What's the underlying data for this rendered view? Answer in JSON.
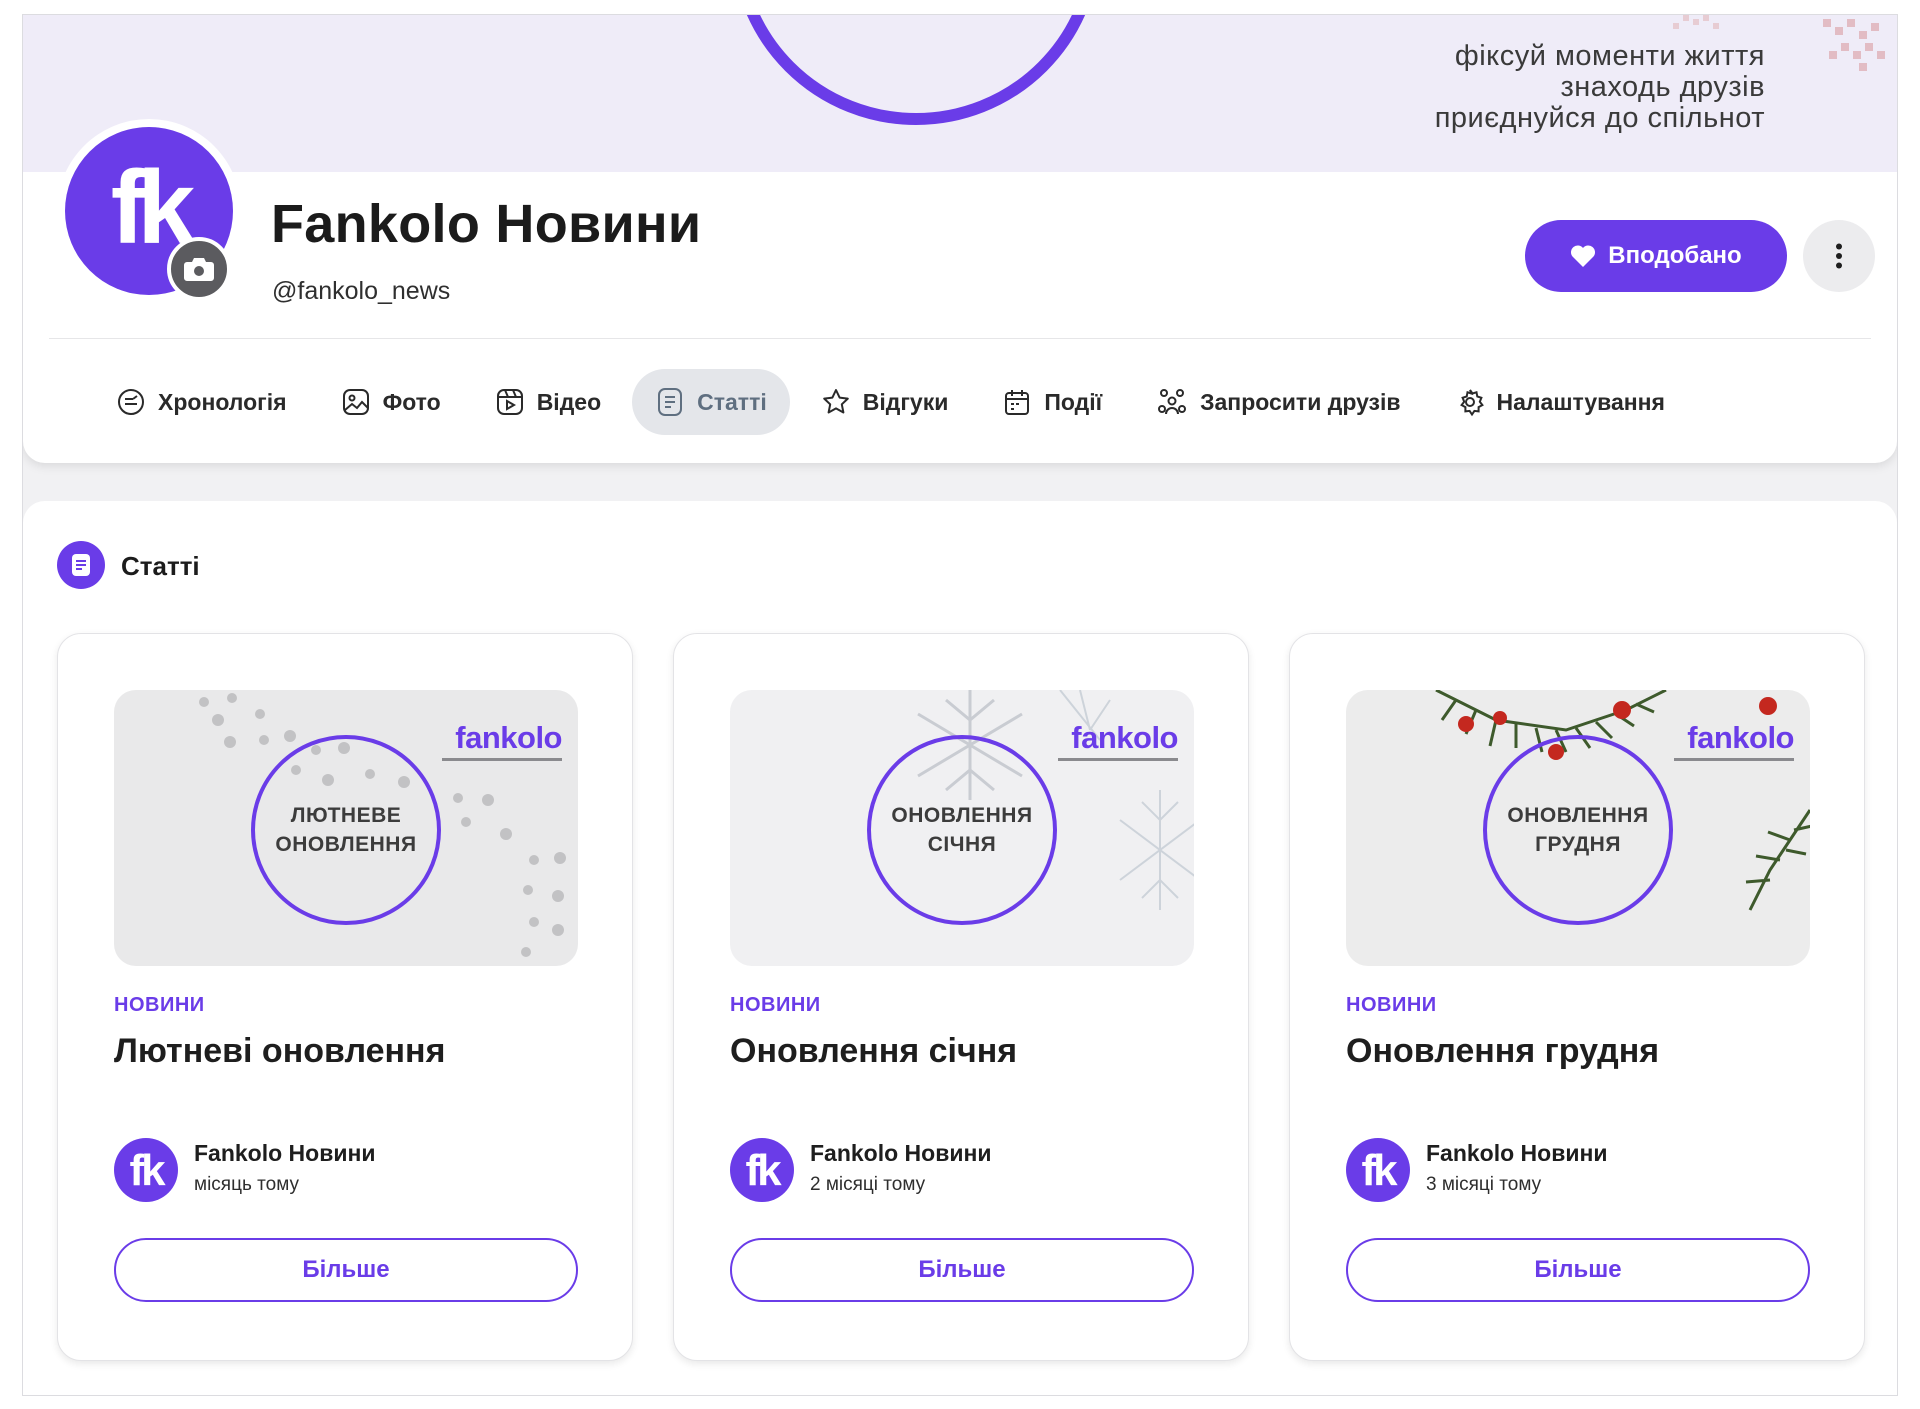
{
  "cover": {
    "tagline": [
      "фіксуй моменти життя",
      "знаходь друзів",
      "приєднуйся до спільнот"
    ]
  },
  "profile": {
    "logo_text": "fk",
    "name": "Fankolo Новини",
    "handle": "@fankolo_news",
    "like_label": "Вподобано",
    "accent": "#6a3ce8"
  },
  "tabs": [
    {
      "label": "Хронологія",
      "icon": "timeline-icon"
    },
    {
      "label": "Фото",
      "icon": "photo-icon"
    },
    {
      "label": "Відео",
      "icon": "video-icon"
    },
    {
      "label": "Статті",
      "icon": "article-icon",
      "active": true
    },
    {
      "label": "Відгуки",
      "icon": "star-icon"
    },
    {
      "label": "Події",
      "icon": "calendar-icon"
    },
    {
      "label": "Запросити друзів",
      "icon": "people-icon"
    },
    {
      "label": "Налаштування",
      "icon": "gear-icon"
    }
  ],
  "section": {
    "title": "Статті"
  },
  "articles": [
    {
      "image_text": "ЛЮТНЕВЕ\nОНОВЛЕННЯ",
      "image_brand": "fankolo",
      "category": "НОВИНИ",
      "title": "Лютневі оновлення",
      "author": "Fankolo Новини",
      "time": "місяць тому",
      "button": "Більше"
    },
    {
      "image_text": "ОНОВЛЕННЯ\nСІЧНЯ",
      "image_brand": "fankolo",
      "category": "НОВИНИ",
      "title": "Оновлення січня",
      "author": "Fankolo Новини",
      "time": "2 місяці тому",
      "button": "Більше"
    },
    {
      "image_text": "ОНОВЛЕННЯ\nГРУДНЯ",
      "image_brand": "fankolo",
      "category": "НОВИНИ",
      "title": "Оновлення грудня",
      "author": "Fankolo Новини",
      "time": "3 місяці тому",
      "button": "Більше"
    }
  ]
}
